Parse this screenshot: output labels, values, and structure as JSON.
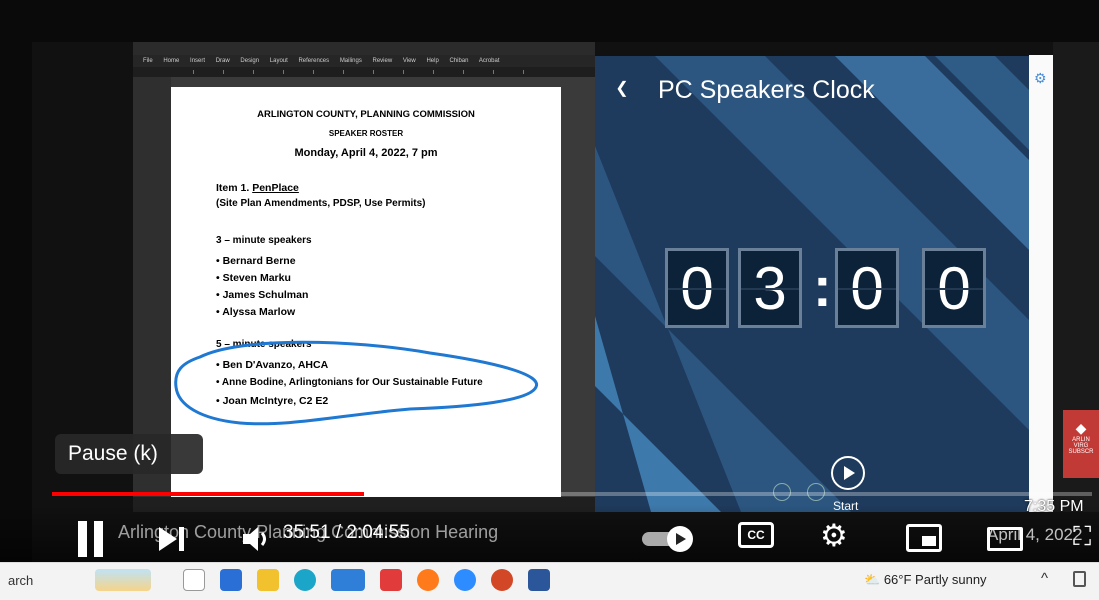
{
  "document": {
    "org": "ARLINGTON COUNTY, PLANNING COMMISSION",
    "roster": "SPEAKER ROSTER",
    "date": "Monday, April 4, 2022, 7 pm",
    "item_title": "Item 1.",
    "item_name": "PenPlace",
    "item_sub": "(Site Plan Amendments, PDSP, Use Permits)",
    "three_min_heading": "3 – minute speakers",
    "three_min_speakers": [
      "Bernard Berne",
      "Steven Marku",
      "James Schulman",
      "Alyssa Marlow"
    ],
    "five_min_heading": "5 – minute speakers",
    "five_min_speakers": [
      "Ben D'Avanzo, AHCA",
      "Anne Bodine, Arlingtonians for Our Sustainable Future",
      "Joan McIntyre, C2 E2"
    ]
  },
  "word_ribbon": [
    "File",
    "Home",
    "Insert",
    "Draw",
    "Design",
    "Layout",
    "References",
    "Mailings",
    "Review",
    "View",
    "Help",
    "Chiban",
    "Acrobat"
  ],
  "clock_app": {
    "title": "PC Speakers Clock",
    "digits": [
      "0",
      "3",
      "0",
      "0"
    ],
    "colon": ":",
    "start_label": "Start"
  },
  "player": {
    "tooltip": "Pause (k)",
    "progress_fraction": 0.3,
    "ghost_title": "Arlington County Planning Commission Hearing",
    "time_display": "35:51 / 2:04:55",
    "clock_overlay": "7:35 PM",
    "date_overlay": "April 4, 2022"
  },
  "taskbar": {
    "search_text": "arch",
    "weather": "66°F  Partly sunny",
    "chevron": "^"
  },
  "colors": {
    "progress": "#ff0000",
    "annotation_circle": "#1f78d1",
    "clock_bg": "#1e3a5c"
  }
}
